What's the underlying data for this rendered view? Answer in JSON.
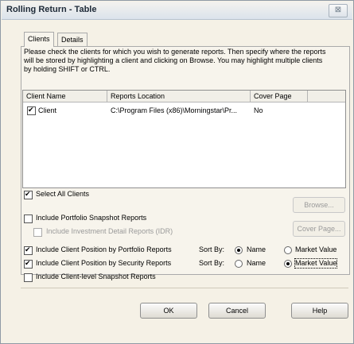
{
  "window": {
    "title": "Rolling Return - Table",
    "close_glyph": "⊠"
  },
  "tabs": [
    {
      "label": "Clients"
    },
    {
      "label": "Details"
    }
  ],
  "instructions": "Please check the clients for which you wish to generate reports. Then specify where the reports will be stored by highlighting a client and clicking on Browse.  You may highlight multiple clients by holding SHIFT or CTRL.",
  "client_table": {
    "columns": [
      "Client Name",
      "Reports Location",
      "Cover Page"
    ],
    "rows": [
      {
        "name": "Client",
        "location": "C:\\Program Files (x86)\\Morningstar\\Pr...",
        "cover": "No",
        "checked": true
      }
    ]
  },
  "options": {
    "select_all": "Select All Clients",
    "portfolio_snapshot": "Include Portfolio Snapshot Reports",
    "investment_detail": "Include Investment Detail Reports (IDR)",
    "position_portfolio": "Include Client Position by Portfolio Reports",
    "position_security": "Include Client Position by Security Reports",
    "client_snapshot": "Include Client-level Snapshot Reports",
    "sort_by": "Sort By:",
    "name": "Name",
    "market_value": "Market Value"
  },
  "buttons": {
    "browse": "Browse...",
    "cover_page": "Cover Page...",
    "ok": "OK",
    "cancel": "Cancel",
    "help": "Help"
  }
}
